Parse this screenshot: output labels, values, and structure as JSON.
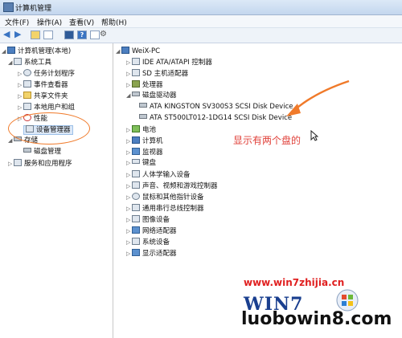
{
  "window": {
    "title": "计算机管理"
  },
  "menu": [
    "文件(F)",
    "操作(A)",
    "查看(V)",
    "帮助(H)"
  ],
  "left_tree": {
    "root": "计算机管理(本地)",
    "system_tools": "系统工具",
    "task_scheduler": "任务计划程序",
    "event_viewer": "事件查看器",
    "shared_folders": "共享文件夹",
    "local_users": "本地用户和组",
    "performance": "性能",
    "device_manager": "设备管理器",
    "storage": "存储",
    "disk_management": "磁盘管理",
    "services_apps": "服务和应用程序"
  },
  "device_tree": {
    "root": "WeiX-PC",
    "ide": "IDE ATA/ATAPI 控制器",
    "sd": "SD 主机适配器",
    "cpu": "处理器",
    "disk_drives": "磁盘驱动器",
    "disks": [
      "ATA KINGSTON SV300S3 SCSI Disk Device",
      "ATA ST500LT012-1DG14 SCSI Disk Device"
    ],
    "battery": "电池",
    "computer": "计算机",
    "monitors": "监视器",
    "keyboard": "键盘",
    "hid": "人体学输入设备",
    "sound": "声音、视频和游戏控制器",
    "mice": "鼠标和其他指针设备",
    "usb": "通用串行总线控制器",
    "imaging": "图像设备",
    "network": "网络适配器",
    "system_devices": "系统设备",
    "display": "显示适配器"
  },
  "annotation": {
    "text": "显示有两个盘的"
  },
  "watermark": {
    "url": "www.win7zhijia.cn",
    "logo": "WIN7",
    "url2": "luobowin8.com"
  }
}
